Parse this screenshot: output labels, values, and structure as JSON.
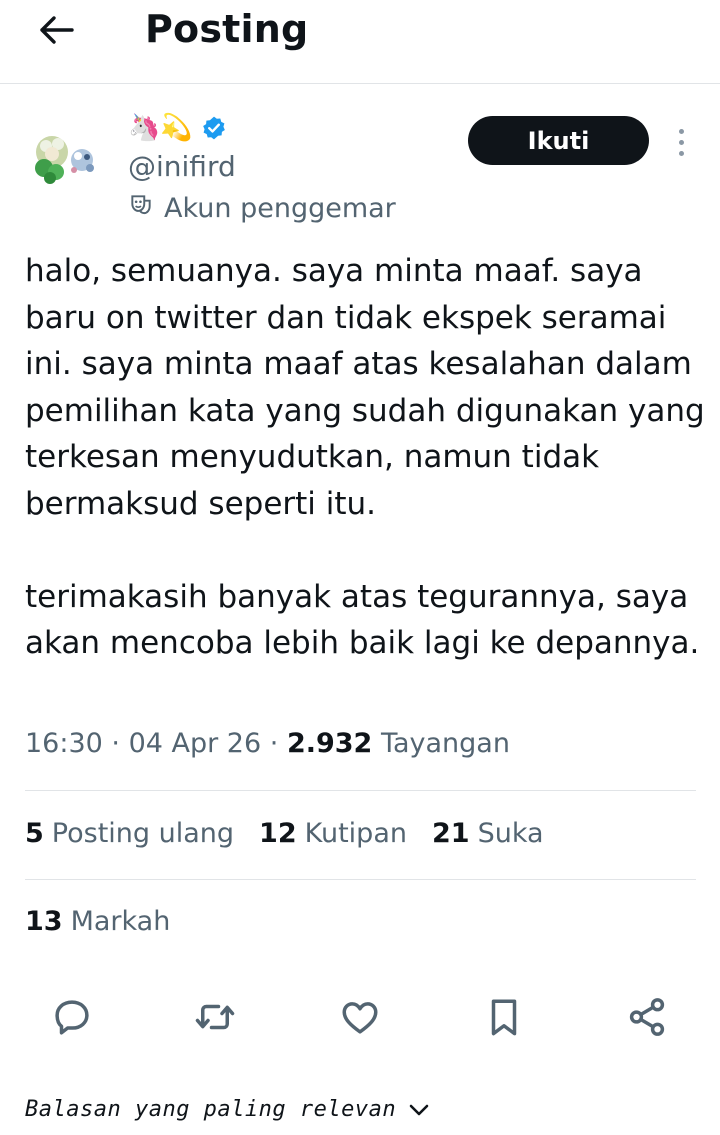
{
  "header": {
    "title": "Posting",
    "back_icon": "arrow-left-icon"
  },
  "author": {
    "display_name_emojis": "🦄💫",
    "handle": "@inifird",
    "verified": true,
    "fan_label": "Akun penggemar",
    "fan_icon": "theater-mask-icon",
    "follow_label": "Ikuti",
    "more_icon": "more-vertical-icon"
  },
  "tweet": {
    "text": "halo, semuanya. saya minta maaf. saya baru on twitter dan tidak ekspek seramai ini. saya minta maaf atas kesalahan dalam pemilihan kata yang sudah digunakan yang terkesan menyudutkan, namun tidak bermaksud seperti itu.\n\nterimakasih banyak atas tegurannya, saya akan mencoba lebih baik lagi ke depannya.",
    "time": "16:30",
    "date": "04 Apr 26",
    "views_count": "2.932",
    "views_label": "Tayangan"
  },
  "stats": {
    "reposts_count": "5",
    "reposts_label": "Posting ulang",
    "quotes_count": "12",
    "quotes_label": "Kutipan",
    "likes_count": "21",
    "likes_label": "Suka",
    "bookmarks_count": "13",
    "bookmarks_label": "Markah"
  },
  "actions": [
    {
      "name": "reply",
      "icon": "reply-icon"
    },
    {
      "name": "repost",
      "icon": "repost-icon"
    },
    {
      "name": "like",
      "icon": "heart-icon"
    },
    {
      "name": "bookmark",
      "icon": "bookmark-icon"
    },
    {
      "name": "share",
      "icon": "share-icon"
    }
  ],
  "replies": {
    "sort_label": "Balasan yang paling relevan",
    "sort_icon": "chevron-down-icon"
  },
  "colors": {
    "text_primary": "#0f1419",
    "text_secondary": "#536471",
    "verified_blue": "#1d9bf0",
    "divider": "#e1e4e7"
  }
}
